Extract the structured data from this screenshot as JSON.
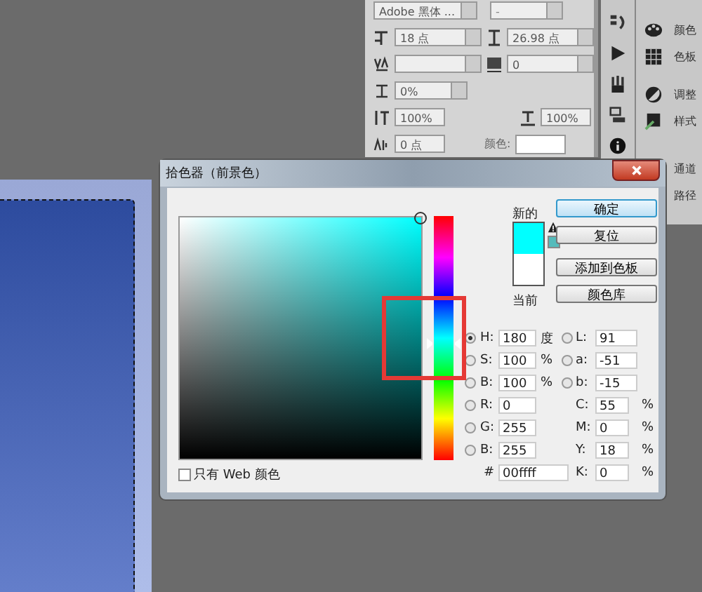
{
  "character_panel": {
    "font_family": "Adobe 黑体 ...",
    "font_style": "-",
    "font_size": "18 点",
    "leading": "26.98 点",
    "tracking": "0",
    "tsume": "0%",
    "vertical_scale": "100%",
    "horizontal_scale": "100%",
    "baseline_shift": "0 点",
    "color_label": "颜色:"
  },
  "dock": {
    "tools": [
      {
        "kind": "history"
      },
      {
        "kind": "play"
      },
      {
        "kind": "brushes"
      },
      {
        "kind": "clone"
      },
      {
        "kind": "info"
      }
    ],
    "panels": [
      {
        "kind": "palette",
        "label": "颜色"
      },
      {
        "kind": "grid",
        "label": "色板"
      },
      {
        "kind": "adjust",
        "label": "调整"
      },
      {
        "kind": "styles",
        "label": "样式"
      },
      {
        "label": "通道"
      },
      {
        "label": "路径"
      }
    ]
  },
  "dialog": {
    "title": "拾色器（前景色）",
    "preview": [
      {
        "label": "新的",
        "color": "#00ffff"
      },
      {
        "label": "当前",
        "color": "#ffffff"
      }
    ],
    "hue_slider": {
      "level": 0.5
    },
    "buttons": [
      {
        "label": "确定",
        "default": true
      },
      {
        "label": "复位",
        "default": false
      },
      {
        "label": "添加到色板",
        "default": false
      },
      {
        "label": "颜色库",
        "default": false
      }
    ],
    "hsb": [
      {
        "label": "H:",
        "value": "180",
        "unit": "度",
        "selected": true
      },
      {
        "label": "S:",
        "value": "100",
        "unit": "%",
        "selected": false
      },
      {
        "label": "B:",
        "value": "100",
        "unit": "%",
        "selected": false
      }
    ],
    "rgb": [
      {
        "label": "R:",
        "value": "0",
        "selected": false
      },
      {
        "label": "G:",
        "value": "255",
        "selected": false
      },
      {
        "label": "B:",
        "value": "255",
        "selected": false
      }
    ],
    "lab": [
      {
        "label": "L:",
        "value": "91",
        "selected": false
      },
      {
        "label": "a:",
        "value": "-51",
        "selected": false
      },
      {
        "label": "b:",
        "value": "-15",
        "selected": false
      }
    ],
    "cmyk": [
      {
        "label": "C:",
        "value": "55",
        "unit": "%"
      },
      {
        "label": "M:",
        "value": "0",
        "unit": "%"
      },
      {
        "label": "Y:",
        "value": "18",
        "unit": "%"
      },
      {
        "label": "K:",
        "value": "0",
        "unit": "%"
      }
    ],
    "hex": {
      "label": "#",
      "value": "00ffff"
    },
    "web_only": {
      "label": "只有 Web 颜色",
      "checked": false
    }
  }
}
